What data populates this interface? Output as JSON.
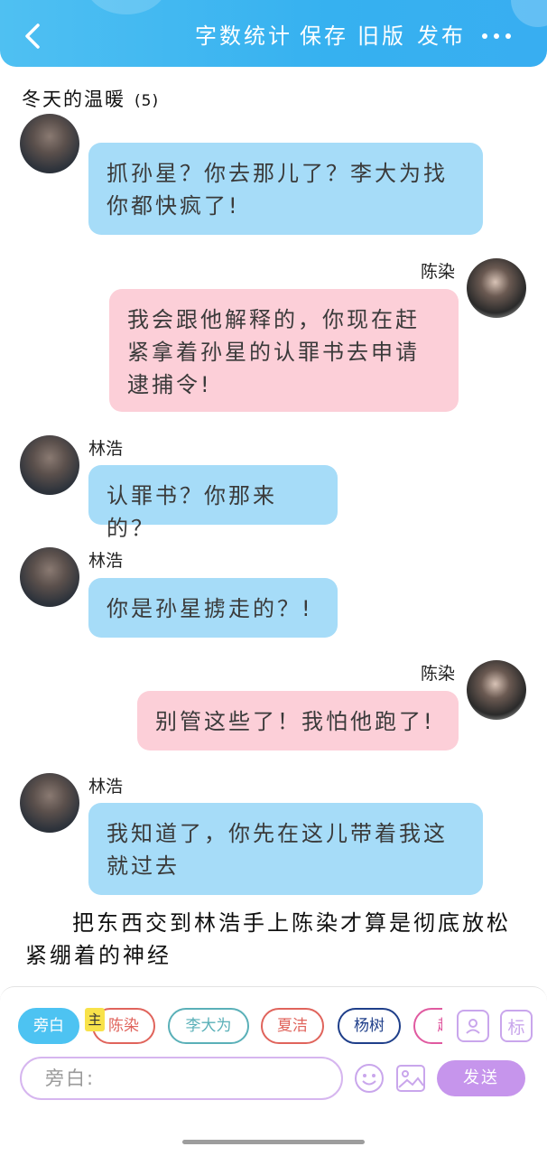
{
  "header": {
    "actions": [
      "字数统计",
      "保存",
      "旧版",
      "发布"
    ]
  },
  "chapter": {
    "title": "冬天的温暖",
    "count": "(5)"
  },
  "messages": [
    {
      "side": "left",
      "sender": "",
      "text": "抓孙星？你去那儿了？李大为找你都快疯了!",
      "color": "blue"
    },
    {
      "side": "right",
      "sender": "陈染",
      "text": "我会跟他解释的，你现在赶紧拿着孙星的认罪书去申请逮捕令!",
      "color": "pink"
    },
    {
      "side": "left",
      "sender": "林浩",
      "text": "认罪书？你那来的？",
      "color": "blue"
    },
    {
      "side": "left",
      "sender": "林浩",
      "text": "你是孙星掳走的？!",
      "color": "blue"
    },
    {
      "side": "right",
      "sender": "陈染",
      "text": "别管这些了！我怕他跑了!",
      "color": "pink"
    },
    {
      "side": "left",
      "sender": "林浩",
      "text": "我知道了，你先在这儿带着我这就过去",
      "color": "blue"
    }
  ],
  "narration": "把东西交到林浩手上陈染才算是彻底放松紧绷着的神经",
  "composer": {
    "roles": [
      {
        "label": "旁白",
        "active": true,
        "color": "#4dc3f2"
      },
      {
        "label": "陈染",
        "active": false,
        "color": "#e0645c"
      },
      {
        "label": "李大为",
        "active": false,
        "color": "#5ab0b8"
      },
      {
        "label": "夏洁",
        "active": false,
        "color": "#e0645c"
      },
      {
        "label": "杨树",
        "active": false,
        "color": "#1f3f8a"
      },
      {
        "label": "赵",
        "active": false,
        "color": "#e05aa0"
      }
    ],
    "main_tag": "主",
    "label_icon": "标",
    "input_placeholder": "旁白:",
    "send_label": "发送"
  },
  "icons": [
    "back-icon",
    "more-icon",
    "add-character-icon",
    "label-icon",
    "emoji-icon",
    "image-icon"
  ]
}
